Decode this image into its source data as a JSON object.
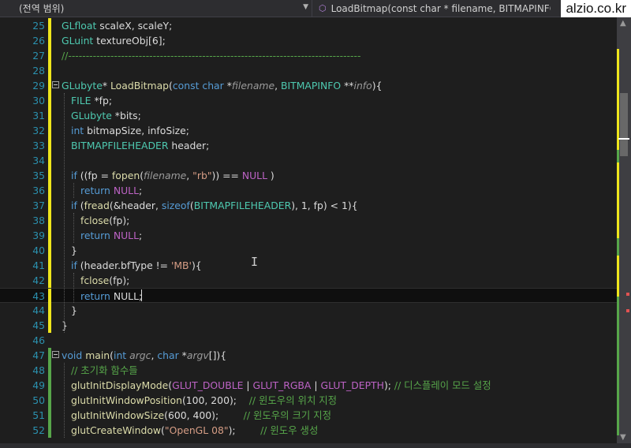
{
  "navbar": {
    "scope": "(전역 범위)",
    "member": "LoadBitmap(const char * filename, BITMAPINFO **",
    "watermark": "alzio.co.kr"
  },
  "editor": {
    "lines": [
      {
        "n": "25",
        "segs": [
          [
            "ty",
            "GLfloat"
          ],
          [
            "plain",
            " scaleX, scaleY;"
          ]
        ]
      },
      {
        "n": "26",
        "segs": [
          [
            "ty",
            "GLuint"
          ],
          [
            "plain",
            " textureObj[6];"
          ]
        ]
      },
      {
        "n": "27",
        "segs": [
          [
            "cm",
            "//-----------------------------------------------------------------------------------"
          ]
        ]
      },
      {
        "n": "28",
        "segs": []
      },
      {
        "n": "29",
        "segs": [
          [
            "ty",
            "GLubyte"
          ],
          [
            "plain",
            "* "
          ],
          [
            "fn",
            "LoadBitmap"
          ],
          [
            "plain",
            "("
          ],
          [
            "kw",
            "const"
          ],
          [
            "plain",
            " "
          ],
          [
            "kw",
            "char"
          ],
          [
            "plain",
            " *"
          ],
          [
            "pr",
            "filename"
          ],
          [
            "plain",
            ", "
          ],
          [
            "ty",
            "BITMAPINFO"
          ],
          [
            "plain",
            " **"
          ],
          [
            "pr",
            "info"
          ],
          [
            "plain",
            "){"
          ]
        ]
      },
      {
        "n": "30",
        "segs": [
          [
            "ty",
            "FILE"
          ],
          [
            "plain",
            " *fp;"
          ]
        ]
      },
      {
        "n": "31",
        "segs": [
          [
            "ty",
            "GLubyte"
          ],
          [
            "plain",
            " *bits;"
          ]
        ]
      },
      {
        "n": "32",
        "segs": [
          [
            "kw",
            "int"
          ],
          [
            "plain",
            " bitmapSize, infoSize;"
          ]
        ]
      },
      {
        "n": "33",
        "segs": [
          [
            "ty",
            "BITMAPFILEHEADER"
          ],
          [
            "plain",
            " header;"
          ]
        ]
      },
      {
        "n": "34",
        "segs": []
      },
      {
        "n": "35",
        "segs": [
          [
            "kw",
            "if"
          ],
          [
            "plain",
            " ((fp = "
          ],
          [
            "fn",
            "fopen"
          ],
          [
            "plain",
            "("
          ],
          [
            "pr",
            "filename"
          ],
          [
            "plain",
            ", "
          ],
          [
            "st",
            "\"rb\""
          ],
          [
            "plain",
            ")) == "
          ],
          [
            "mc",
            "NULL"
          ],
          [
            "plain",
            " )"
          ]
        ]
      },
      {
        "n": "36",
        "segs": [
          [
            "kw",
            "return"
          ],
          [
            "plain",
            " "
          ],
          [
            "mc",
            "NULL"
          ],
          [
            "plain",
            ";"
          ]
        ]
      },
      {
        "n": "37",
        "segs": [
          [
            "kw",
            "if"
          ],
          [
            "plain",
            " ("
          ],
          [
            "fn",
            "fread"
          ],
          [
            "plain",
            "(&header, "
          ],
          [
            "kw",
            "sizeof"
          ],
          [
            "plain",
            "("
          ],
          [
            "ty",
            "BITMAPFILEHEADER"
          ],
          [
            "plain",
            "), 1, fp) < 1){"
          ]
        ]
      },
      {
        "n": "38",
        "segs": [
          [
            "fn",
            "fclose"
          ],
          [
            "plain",
            "(fp);"
          ]
        ]
      },
      {
        "n": "39",
        "segs": [
          [
            "kw",
            "return"
          ],
          [
            "plain",
            " "
          ],
          [
            "mc",
            "NULL"
          ],
          [
            "plain",
            ";"
          ]
        ]
      },
      {
        "n": "40",
        "segs": [
          [
            "plain",
            "}"
          ]
        ]
      },
      {
        "n": "41",
        "segs": [
          [
            "kw",
            "if"
          ],
          [
            "plain",
            " (header.bfType != "
          ],
          [
            "st",
            "'MB'"
          ],
          [
            "plain",
            "){"
          ]
        ]
      },
      {
        "n": "42",
        "segs": [
          [
            "fn",
            "fclose"
          ],
          [
            "plain",
            "(fp);"
          ]
        ]
      },
      {
        "n": "43",
        "segs": [
          [
            "kw",
            "return"
          ],
          [
            "plain",
            " NULL;"
          ]
        ]
      },
      {
        "n": "44",
        "segs": [
          [
            "plain",
            "}"
          ]
        ]
      },
      {
        "n": "45",
        "segs": [
          [
            "plain",
            "}"
          ]
        ]
      },
      {
        "n": "46",
        "segs": []
      },
      {
        "n": "47",
        "segs": [
          [
            "kw",
            "void"
          ],
          [
            "plain",
            " "
          ],
          [
            "fn",
            "main"
          ],
          [
            "plain",
            "("
          ],
          [
            "kw",
            "int"
          ],
          [
            "plain",
            " "
          ],
          [
            "pr",
            "argc"
          ],
          [
            "plain",
            ", "
          ],
          [
            "kw",
            "char"
          ],
          [
            "plain",
            " *"
          ],
          [
            "pr",
            "argv"
          ],
          [
            "plain",
            "[]){"
          ]
        ]
      },
      {
        "n": "48",
        "segs": [
          [
            "cm",
            "// 초기화 함수들"
          ]
        ]
      },
      {
        "n": "49",
        "segs": [
          [
            "fn",
            "glutInitDisplayMode"
          ],
          [
            "plain",
            "("
          ],
          [
            "mc",
            "GLUT_DOUBLE"
          ],
          [
            "plain",
            " | "
          ],
          [
            "mc",
            "GLUT_RGBA"
          ],
          [
            "plain",
            " | "
          ],
          [
            "mc",
            "GLUT_DEPTH"
          ],
          [
            "plain",
            "); "
          ],
          [
            "cm",
            "// 디스플레이 모드 설정"
          ]
        ]
      },
      {
        "n": "50",
        "segs": [
          [
            "fn",
            "glutInitWindowPosition"
          ],
          [
            "plain",
            "(100, 200);    "
          ],
          [
            "cm",
            "// 윈도우의 위치 지정"
          ]
        ]
      },
      {
        "n": "51",
        "segs": [
          [
            "fn",
            "glutInitWindowSize"
          ],
          [
            "plain",
            "(600, 400);        "
          ],
          [
            "cm",
            "// 윈도우의 크기 지정"
          ]
        ]
      },
      {
        "n": "52",
        "segs": [
          [
            "fn",
            "glutCreateWindow"
          ],
          [
            "plain",
            "("
          ],
          [
            "st",
            "\"OpenGL 08\""
          ],
          [
            "plain",
            ");        "
          ],
          [
            "cm",
            "// 윈도우 생성"
          ]
        ]
      }
    ]
  },
  "colors": {
    "background": "#1e1e1e",
    "keyword": "#569cd6",
    "type": "#4ec9b0",
    "function": "#dcdcaa",
    "string": "#d69d85",
    "comment": "#57a64a",
    "macro": "#bd63c5",
    "line_number": "#2b91af",
    "change_saved": "#57a64a",
    "change_unsaved": "#efe61c"
  },
  "icons": {
    "member": "method-cube-icon",
    "dropdown": "chevron-down-icon"
  }
}
